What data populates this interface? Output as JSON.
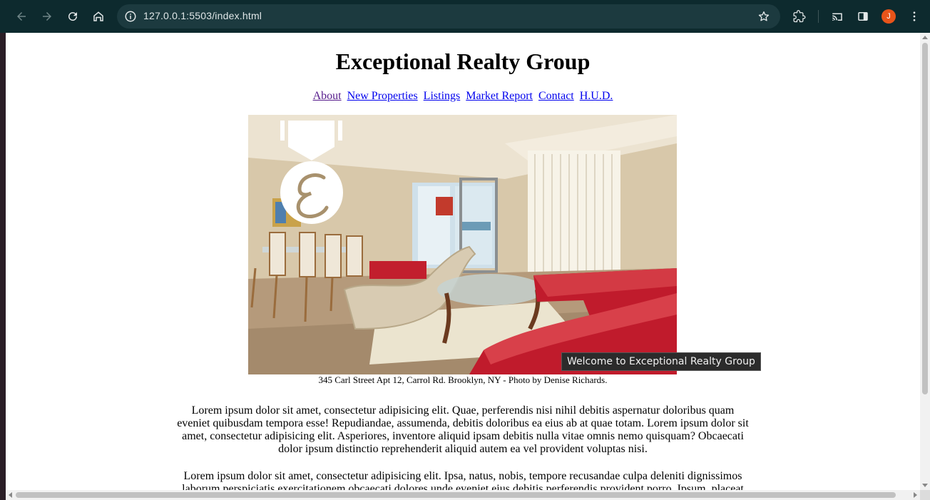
{
  "browser": {
    "url": "127.0.0.1:5503/index.html",
    "profile_initial": "J",
    "profile_color": "#e8541a"
  },
  "page": {
    "title": "Exceptional Realty Group",
    "nav": [
      {
        "label": "About",
        "visited": true
      },
      {
        "label": "New Properties",
        "visited": false
      },
      {
        "label": "Listings",
        "visited": false
      },
      {
        "label": "Market Report",
        "visited": false
      },
      {
        "label": "Contact",
        "visited": false
      },
      {
        "label": "H.U.D.",
        "visited": false
      }
    ],
    "caption": "345 Carl Street Apt 12, Carrol Rd. Brooklyn, NY - Photo by Denise Richards.",
    "paragraphs": [
      "Lorem ipsum dolor sit amet, consectetur adipisicing elit. Quae, perferendis nisi nihil debitis aspernatur doloribus quam eveniet quibusdam tempora esse! Repudiandae, assumenda, debitis doloribus ea eius ab at quae totam. Lorem ipsum dolor sit amet, consectetur adipisicing elit. Asperiores, inventore aliquid ipsam debitis nulla vitae omnis nemo quisquam? Obcaecati dolor ipsum distinctio reprehenderit aliquid autem ea vel provident voluptas nisi.",
      "Lorem ipsum dolor sit amet, consectetur adipisicing elit. Ipsa, natus, nobis, tempore recusandae culpa deleniti dignissimos laborum perspiciatis exercitationem obcaecati dolores unde eveniet eius debitis perferendis provident porro. Ipsum, placeat"
    ],
    "tooltip": "Welcome to Exceptional Realty Group",
    "link_color": "#0000ee",
    "visited_link_color": "#551a8b"
  },
  "icons": {
    "back": "arrow-left-icon",
    "forward": "arrow-right-icon",
    "reload": "reload-icon",
    "home": "home-icon",
    "site_info": "info-icon",
    "bookmark": "star-icon",
    "extensions": "puzzle-icon",
    "cast": "cast-icon",
    "side_panel": "side-panel-icon",
    "menu": "kebab-menu-icon"
  }
}
